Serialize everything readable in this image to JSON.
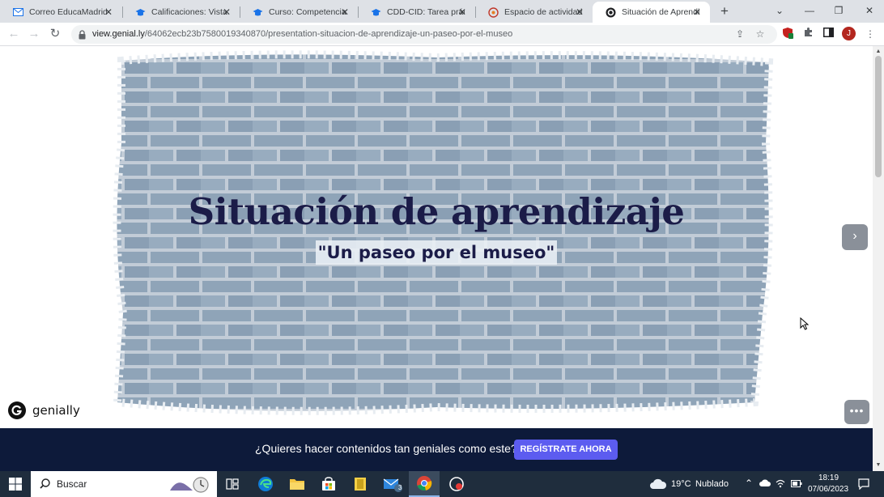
{
  "browser": {
    "tabs": [
      {
        "title": "Correo EducaMadrid",
        "icon": "mail-icon",
        "active": false
      },
      {
        "title": "Calificaciones: Vista",
        "icon": "mortarboard-icon",
        "active": false
      },
      {
        "title": "Curso: Competencia D",
        "icon": "mortarboard-icon",
        "active": false
      },
      {
        "title": "CDD-CID: Tarea práct",
        "icon": "mortarboard-icon",
        "active": false
      },
      {
        "title": "Espacio de actividades",
        "icon": "activity-icon",
        "active": false
      },
      {
        "title": "Situación de Aprendiz",
        "icon": "genially-icon",
        "active": true
      }
    ],
    "new_tab_label": "+",
    "url_host": "view.genial.ly",
    "url_path": "/64062ecb23b7580019340870/presentation-situacion-de-aprendizaje-un-paseo-por-el-museo",
    "profile_initial": "J",
    "extension_badge": "1"
  },
  "presentation": {
    "title": "Situación de aprendizaje",
    "subtitle": "\"Un paseo por el museo\"",
    "logo_text": "genially",
    "banner_text": "¿Quieres hacer contenidos tan geniales como este?",
    "banner_button": "REGÍSTRATE AHORA"
  },
  "taskbar": {
    "search_placeholder": "Buscar",
    "weather_temp": "19°C",
    "weather_text": "Nublado",
    "time": "18:19",
    "date": "07/06/2023",
    "mail_badge": "3"
  },
  "colors": {
    "title": "#1b1c48",
    "banner_bg": "#0d1a3a",
    "banner_button": "#5c5cf0",
    "taskbar": "#1f2d3d"
  }
}
